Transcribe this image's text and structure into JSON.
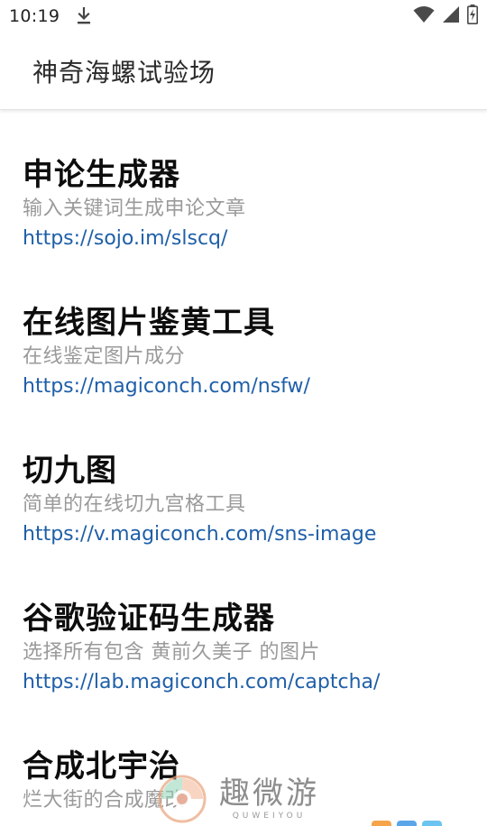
{
  "status_bar": {
    "time": "10:19",
    "download_icon": "download-icon",
    "wifi_icon": "wifi-icon",
    "signal_icon": "signal-icon",
    "battery_icon": "battery-charging-icon"
  },
  "app_bar": {
    "title": "神奇海螺试验场"
  },
  "items": [
    {
      "title": "申论生成器",
      "description": "输入关键词生成申论文章",
      "link": "https://sojo.im/slscq/"
    },
    {
      "title": "在线图片鉴黄工具",
      "description": "在线鉴定图片成分",
      "link": "https://magiconch.com/nsfw/"
    },
    {
      "title": "切九图",
      "description": "简单的在线切九宫格工具",
      "link": "https://v.magiconch.com/sns-image"
    },
    {
      "title": "谷歌验证码生成器",
      "description": "选择所有包含 黄前久美子 的图片",
      "link": "https://lab.magiconch.com/captcha/"
    },
    {
      "title": "合成北宇治",
      "description": "烂大街的合成魔改"
    }
  ],
  "watermark": {
    "text_cn": "趣微游",
    "text_en": "QUWEIYOU"
  },
  "colors": {
    "link": "#1f5fa8",
    "description": "#9a9a9a",
    "title": "#0d0d0d"
  }
}
